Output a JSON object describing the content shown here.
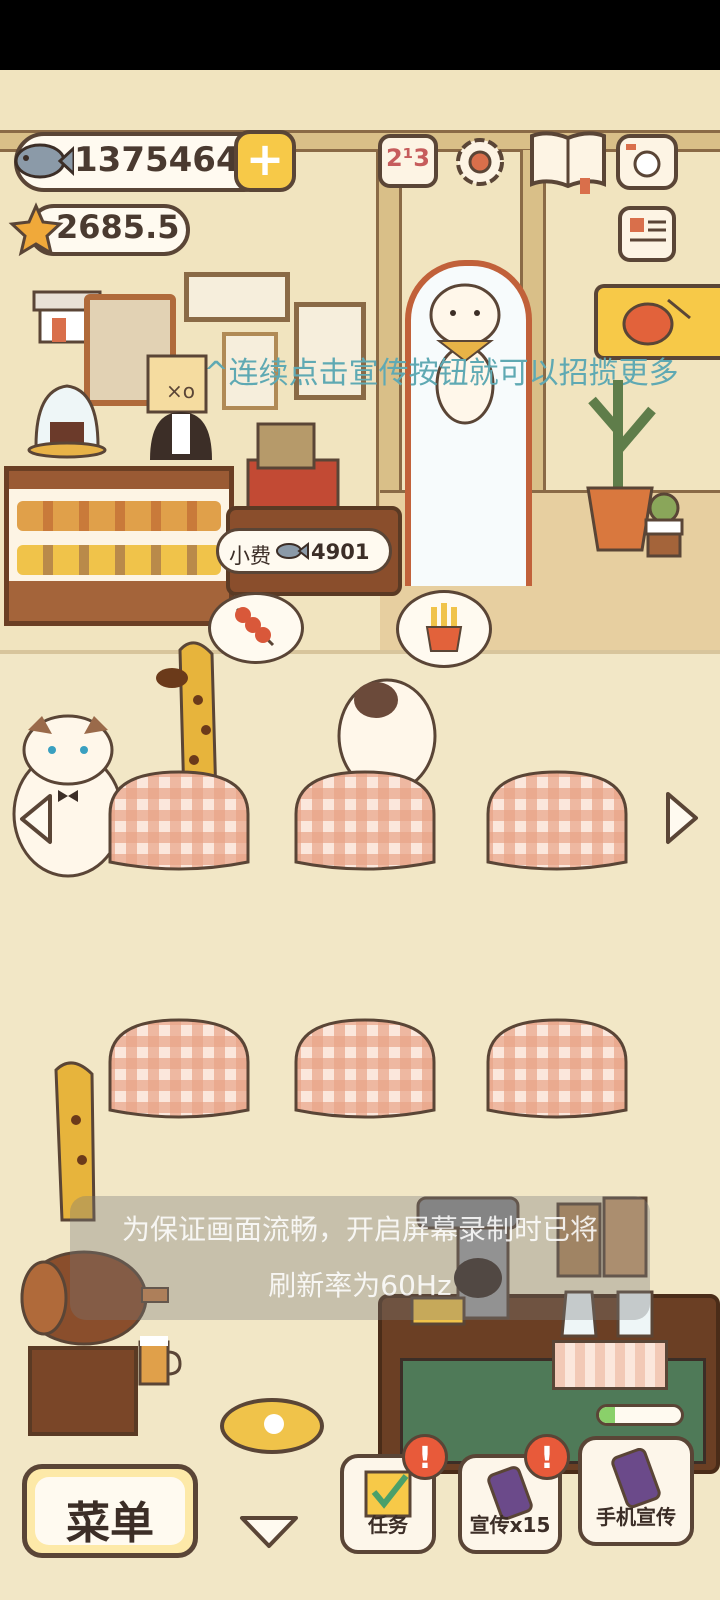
{
  "status_bar": {
    "background": "#000000"
  },
  "currency": {
    "fish_amount": "1375464",
    "star_amount": "2685.5",
    "plus_label": "+"
  },
  "hint_banner": "^o^连续点击宣传按钮就可以招揽更多",
  "tip_bubble": {
    "label": "小费",
    "amount": "4901"
  },
  "orders": {
    "left_order": "skewer-food-icon",
    "right_order": "fries-food-icon"
  },
  "toast": {
    "line1": "为保证画面流畅，开启屏幕录制时已将",
    "line2": "刷新率为60Hz"
  },
  "bottom_bar": {
    "menu_label": "菜单",
    "task_label": "任务",
    "promote_label": "宣传x15",
    "phone_promote_label": "手机宣传",
    "alert_mark": "!"
  },
  "progress": {
    "fraction": 0.2
  },
  "colors": {
    "wall": "#f2e7c6",
    "outline": "#5a4536",
    "accent_yellow": "#f7c948",
    "alert_red": "#e85a3a",
    "table_check": "#e9a487"
  }
}
